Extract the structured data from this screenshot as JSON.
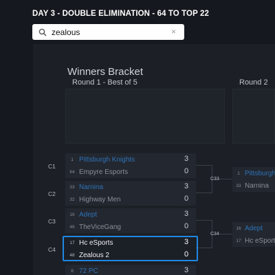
{
  "header": {
    "title": "DAY 3 - DOUBLE ELIMINATION - 64 TO TOP 22"
  },
  "search": {
    "value": "zealous",
    "clear_glyph": "×"
  },
  "bracket": {
    "title": "Winners Bracket",
    "rounds": [
      {
        "label": "Round 1 - Best of 5"
      },
      {
        "label": "Round 2"
      }
    ],
    "round1_matches": [
      {
        "label": "C1",
        "teams": [
          {
            "seed": "1",
            "name": "Pittsburgh Knights",
            "score": "3",
            "winner": true
          },
          {
            "seed": "64",
            "name": "Empyre Esports",
            "score": "0",
            "winner": false
          }
        ]
      },
      {
        "label": "C2",
        "teams": [
          {
            "seed": "33",
            "name": "Narnina",
            "score": "3",
            "winner": true
          },
          {
            "seed": "32",
            "name": "Highway Men",
            "score": "0",
            "winner": false
          }
        ]
      },
      {
        "label": "C3",
        "teams": [
          {
            "seed": "16",
            "name": "Adept",
            "score": "3",
            "winner": true
          },
          {
            "seed": "49",
            "name": "TheViceGang",
            "score": "0",
            "winner": false
          }
        ]
      },
      {
        "label": "C4",
        "teams": [
          {
            "seed": "17",
            "name": "Hc eSports",
            "score": "3",
            "winner": true
          },
          {
            "seed": "48",
            "name": "Zealous 2",
            "score": "0",
            "winner": false
          }
        ]
      },
      {
        "label": "",
        "teams": [
          {
            "seed": "8",
            "name": "72 PC",
            "score": "3",
            "winner": true
          }
        ]
      }
    ],
    "round2_matches": [
      {
        "label": "C33",
        "teams": [
          {
            "seed": "1",
            "name": "Pittsburgh Knights",
            "winner": true
          },
          {
            "seed": "33",
            "name": "Narnina",
            "winner": false
          }
        ]
      },
      {
        "label": "C34",
        "teams": [
          {
            "seed": "16",
            "name": "Adept",
            "winner": true
          },
          {
            "seed": "17",
            "name": "Hc eSports",
            "winner": false
          }
        ]
      }
    ]
  },
  "colors": {
    "winner": "#2d73b8",
    "highlight": "#1e88e5",
    "background": "#15181e"
  },
  "icons": {
    "search": "search-icon",
    "clear": "close-icon"
  }
}
